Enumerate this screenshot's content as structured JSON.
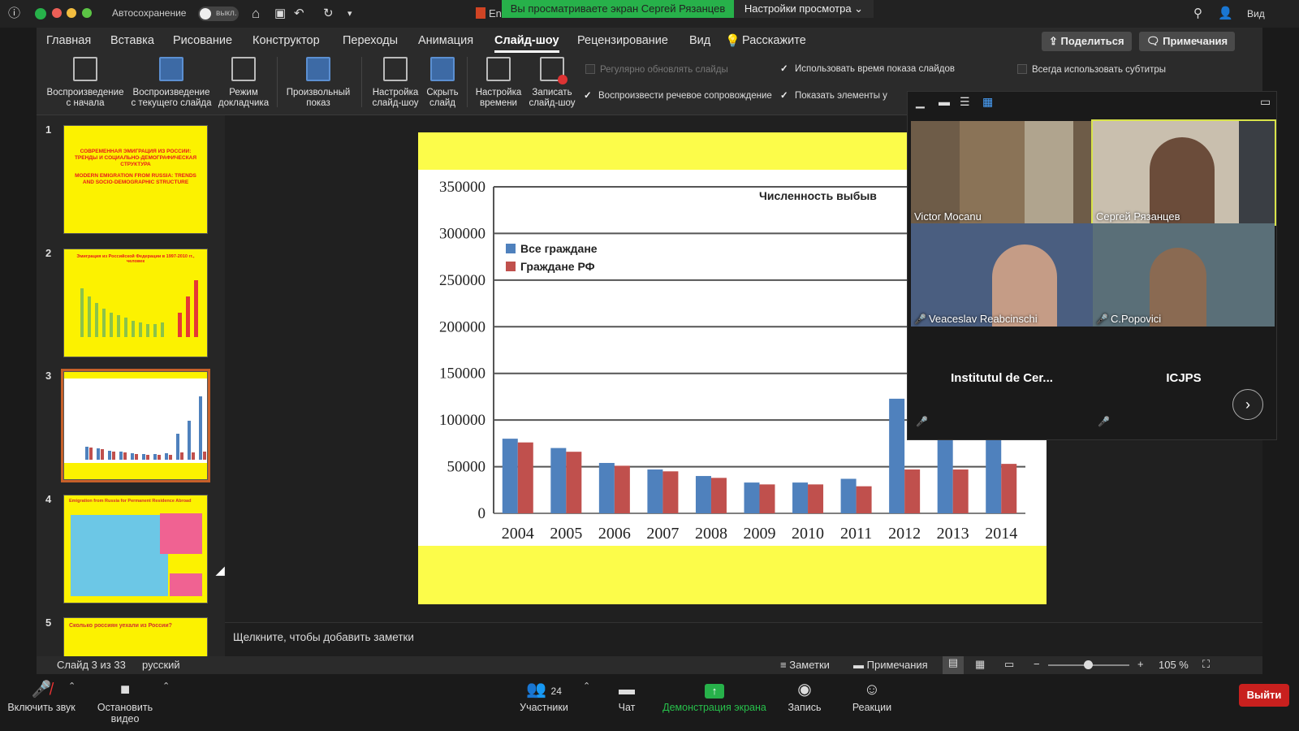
{
  "titlebar": {
    "autosave_label": "Автосохранение",
    "autosave_state": "выкл.",
    "doc_name": "En",
    "view_label": "Вид"
  },
  "share_banner": "Вы просматриваете экран Сергей Рязанцев",
  "view_settings": "Настройки просмотра",
  "menu": [
    "Главная",
    "Вставка",
    "Рисование",
    "Конструктор",
    "Переходы",
    "Анимация",
    "Слайд-шоу",
    "Рецензирование",
    "Вид",
    "Расскажите"
  ],
  "share_button": "Поделиться",
  "comments_button": "Примечания",
  "ribbon": {
    "buttons": [
      {
        "line1": "Воспроизведение",
        "line2": "с начала"
      },
      {
        "line1": "Воспроизведение",
        "line2": "с текущего слайда"
      },
      {
        "line1": "Режим",
        "line2": "докладчика"
      },
      {
        "line1": "Произвольный",
        "line2": "показ"
      },
      {
        "line1": "Настройка",
        "line2": "слайд-шоу"
      },
      {
        "line1": "Скрыть",
        "line2": "слайд"
      },
      {
        "line1": "Настройка",
        "line2": "времени"
      },
      {
        "line1": "Записать",
        "line2": "слайд-шоу"
      }
    ],
    "checks": {
      "update": "Регулярно обновлять слайды",
      "timings": "Использовать время показа слайдов",
      "subtitles": "Всегда использовать субтитры",
      "narration": "Воспроизвести речевое сопровождение",
      "controls": "Показать элементы у"
    }
  },
  "thumbs": {
    "n1": "1",
    "n2": "2",
    "n3": "3",
    "n4": "4",
    "n5": "5",
    "t1_title": "СОВРЕМЕННАЯ ЭМИГРАЦИЯ ИЗ РОССИИ: ТРЕНДЫ И СОЦИАЛЬНО-ДЕМОГРАФИЧЕСКАЯ СТРУКТУРА",
    "t1_title_en": "MODERN EMIGRATION FROM RUSSIA: TRENDS AND SOCIO-DEMOGRAPHIC STRUCTURE",
    "t2_title": "Эмиграция из Российской Федерации в 1997-2010 гг., человек",
    "t4_title": "Emigration from Russia for Permanent Residence Abroad",
    "t5_title": "Сколько россиян уехали из России?"
  },
  "notes_placeholder": "Щелкните, чтобы добавить заметки",
  "status": {
    "slide_counter": "Слайд 3 из 33",
    "language": "русский",
    "notes": "Заметки",
    "comments": "Примечания",
    "zoom": "105 %"
  },
  "gallery": {
    "p1": "Victor Mocanu",
    "p2": "Сергей Рязанцев",
    "p3": "Veaceslav Reabcinschi",
    "p4": "C.Popovici",
    "p5": "Institutul de Cer...",
    "p6": "ICJPS"
  },
  "zoom_toolbar": {
    "mute": "Включить звук",
    "video": "Остановить видео",
    "participants": "Участники",
    "participants_count": "24",
    "chat": "Чат",
    "share": "Демонстрация экрана",
    "record": "Запись",
    "reactions": "Реакции",
    "leave": "Выйти"
  },
  "chart_data": {
    "type": "bar",
    "title": "Численность выбыв",
    "categories": [
      "2004",
      "2005",
      "2006",
      "2007",
      "2008",
      "2009",
      "2010",
      "2011",
      "2012",
      "2013",
      "2014"
    ],
    "ylim": [
      0,
      350000
    ],
    "yticks": [
      "350000",
      "300000",
      "250000",
      "200000",
      "150000",
      "100000",
      "50000",
      "0"
    ],
    "legend_position": "top-left",
    "series": [
      {
        "name": "Все граждане",
        "color": "#4f81bd",
        "values": [
          80000,
          70000,
          54000,
          47000,
          40000,
          33000,
          33000,
          37000,
          122850,
          186382,
          308475
        ]
      },
      {
        "name": "Граждане РФ",
        "color": "#c0504d",
        "values": [
          76000,
          66000,
          51000,
          45000,
          38000,
          31000,
          31000,
          29000,
          47000,
          47000,
          53000
        ]
      }
    ]
  }
}
